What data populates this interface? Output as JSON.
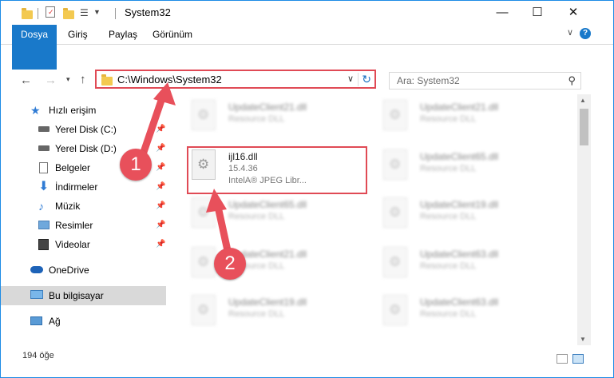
{
  "window": {
    "title": "System32",
    "controls": {
      "minimize": "—",
      "maximize": "☐",
      "close": "✕"
    }
  },
  "ribbon": {
    "tabs": [
      "Dosya",
      "Giriş",
      "Paylaş",
      "Görünüm"
    ],
    "help": "?"
  },
  "address": {
    "path": "C:\\Windows\\System32",
    "search_placeholder": "Ara: System32"
  },
  "sidebar": {
    "items": [
      {
        "label": "Hızlı erişim",
        "icon": "star-icon"
      },
      {
        "label": "Yerel Disk (C:)",
        "icon": "drive-icon",
        "pinned": true
      },
      {
        "label": "Yerel Disk (D:)",
        "icon": "drive-icon",
        "pinned": true
      },
      {
        "label": "Belgeler",
        "icon": "documents-icon",
        "pinned": true
      },
      {
        "label": "İndirmeler",
        "icon": "download-icon",
        "pinned": true
      },
      {
        "label": "Müzik",
        "icon": "music-icon",
        "pinned": true
      },
      {
        "label": "Resimler",
        "icon": "pictures-icon",
        "pinned": true
      },
      {
        "label": "Videolar",
        "icon": "video-icon",
        "pinned": true
      },
      {
        "label": "OneDrive",
        "icon": "cloud-icon"
      },
      {
        "label": "Bu bilgisayar",
        "icon": "computer-icon",
        "selected": true
      },
      {
        "label": "Ağ",
        "icon": "network-icon"
      }
    ]
  },
  "files": [
    {
      "name": "UpdateClient21.dll",
      "type": "Resource DLL"
    },
    {
      "name": "UpdateClient21.dll",
      "type": "Resource DLL"
    },
    {
      "name": "ijl16.dll",
      "version": "15.4.36",
      "description": "IntelA® JPEG Libr..."
    },
    {
      "name": "UpdateClient65.dll",
      "type": "Resource DLL"
    },
    {
      "name": "UpdateClient65.dll",
      "type": "Resource DLL"
    },
    {
      "name": "UpdateClient19.dll",
      "type": "Resource DLL"
    },
    {
      "name": "UpdateClient21.dll",
      "type": "Resource DLL"
    },
    {
      "name": "UpdateClient63.dll",
      "type": "Resource DLL"
    },
    {
      "name": "UpdateClient19.dll",
      "type": "Resource DLL"
    },
    {
      "name": "UpdateClient63.dll",
      "type": "Resource DLL"
    }
  ],
  "status": {
    "item_count": "194 öğe"
  },
  "annotations": {
    "step1": "1",
    "step2": "2",
    "color": "#e8505b"
  }
}
